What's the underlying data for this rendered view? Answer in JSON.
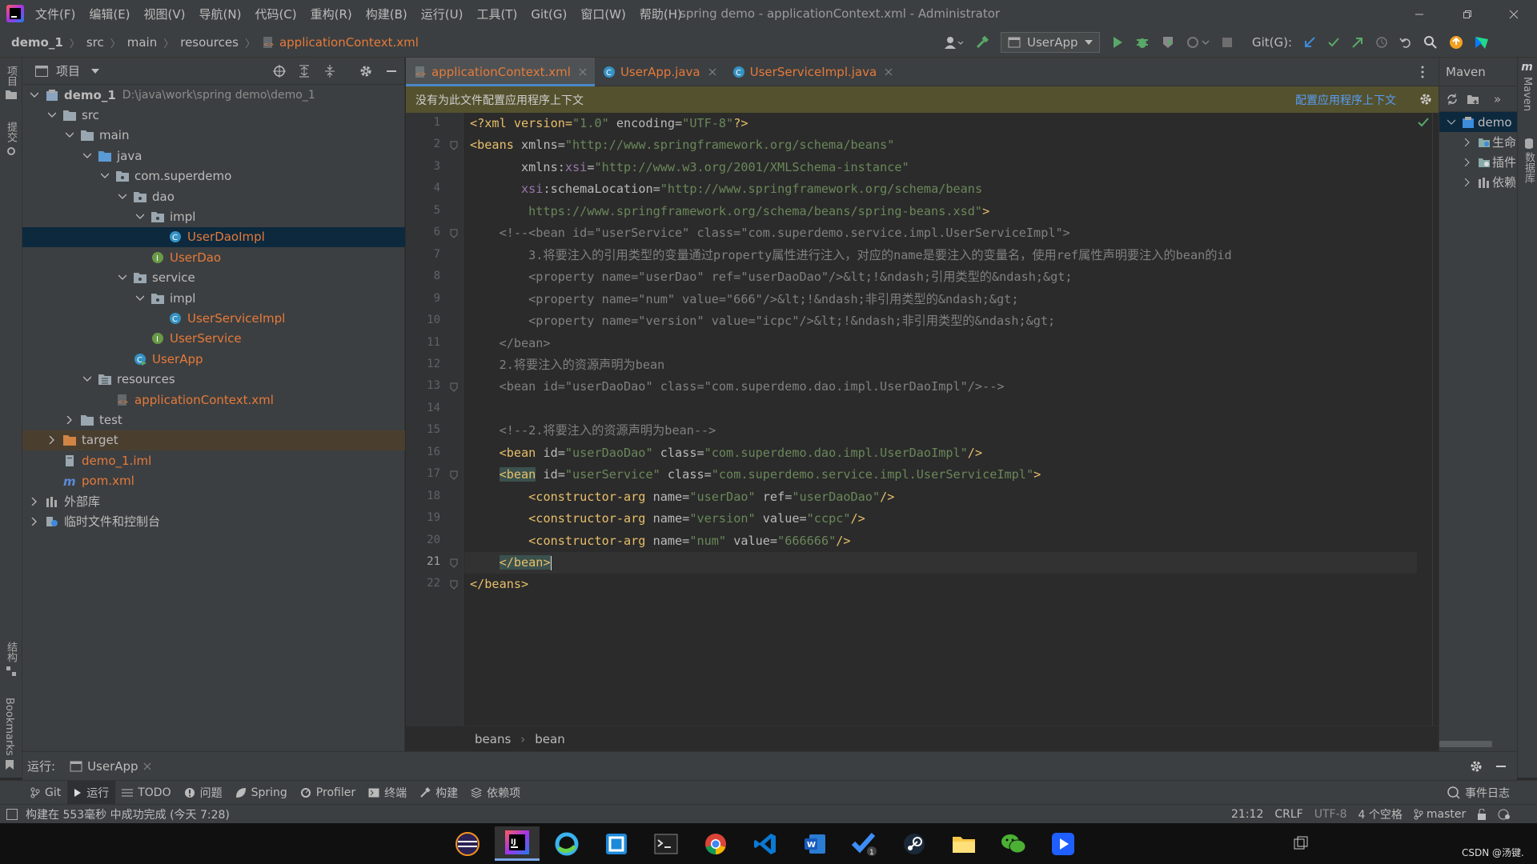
{
  "menubar": {
    "items": [
      "文件(F)",
      "编辑(E)",
      "视图(V)",
      "导航(N)",
      "代码(C)",
      "重构(R)",
      "构建(B)",
      "运行(U)",
      "工具(T)",
      "Git(G)",
      "窗口(W)",
      "帮助(H)"
    ],
    "title": "spring demo - applicationContext.xml - Administrator"
  },
  "navbar": {
    "crumbs": [
      "demo_1",
      "src",
      "main",
      "resources",
      "applicationContext.xml"
    ],
    "run_config": "UserApp",
    "git_label": "Git(G):"
  },
  "leftstrip": {
    "project": "项目",
    "commit": "提交",
    "structure": "结构",
    "bookmarks": "Bookmarks"
  },
  "project": {
    "header": "项目",
    "tree": [
      {
        "label": "demo_1",
        "path": "D:\\java\\work\\spring demo\\demo_1"
      },
      {
        "label": "src"
      },
      {
        "label": "main"
      },
      {
        "label": "java"
      },
      {
        "label": "com.superdemo"
      },
      {
        "label": "dao"
      },
      {
        "label": "impl"
      },
      {
        "label": "UserDaoImpl"
      },
      {
        "label": "UserDao"
      },
      {
        "label": "service"
      },
      {
        "label": "impl"
      },
      {
        "label": "UserServiceImpl"
      },
      {
        "label": "UserService"
      },
      {
        "label": "UserApp"
      },
      {
        "label": "resources"
      },
      {
        "label": "applicationContext.xml"
      },
      {
        "label": "test"
      },
      {
        "label": "target"
      },
      {
        "label": "demo_1.iml"
      },
      {
        "label": "pom.xml"
      },
      {
        "label": "外部库"
      },
      {
        "label": "临时文件和控制台"
      }
    ]
  },
  "tabs": [
    {
      "label": "applicationContext.xml",
      "active": true
    },
    {
      "label": "UserApp.java",
      "active": false
    },
    {
      "label": "UserServiceImpl.java",
      "active": false
    }
  ],
  "banner": {
    "text": "没有为此文件配置应用程序上下文",
    "action": "配置应用程序上下文"
  },
  "editor": {
    "line_numbers": [
      "1",
      "2",
      "3",
      "4",
      "5",
      "6",
      "7",
      "8",
      "9",
      "10",
      "11",
      "12",
      "13",
      "14",
      "15",
      "16",
      "17",
      "18",
      "19",
      "20",
      "21",
      "22"
    ],
    "current_line": "21",
    "lines": [
      [
        "<?xml version=",
        "\"1.0\"",
        " encoding=",
        "\"UTF-8\"",
        "?>"
      ],
      [
        "<beans",
        " xmlns=",
        "\"http://www.springframework.org/schema/beans\""
      ],
      [
        "       xmlns:",
        "xsi",
        "=",
        "\"http://www.w3.org/2001/XMLSchema-instance\""
      ],
      [
        "       ",
        "xsi",
        ":schemaLocation=",
        "\"http://www.springframework.org/schema/beans"
      ],
      [
        "        https://www.springframework.org/schema/beans/spring-beans.xsd\"",
        ">"
      ],
      [
        "    <!--<bean id=\"userService\" class=\"com.superdemo.service.impl.UserServiceImpl\">"
      ],
      [
        "        3.将要注入的引用类型的变量通过property属性进行注入，对应的name是要注入的变量名，使用ref属性声明要注入的bean的id"
      ],
      [
        "        <property name=\"userDao\" ref=\"userDaoDao\"/>&lt;!&ndash;引用类型的&ndash;&gt;"
      ],
      [
        "        <property name=\"num\" value=\"666\"/>&lt;!&ndash;非引用类型的&ndash;&gt;"
      ],
      [
        "        <property name=\"version\" value=\"icpc\"/>&lt;!&ndash;非引用类型的&ndash;&gt;"
      ],
      [
        "    </bean>"
      ],
      [
        "    2.将要注入的资源声明为bean"
      ],
      [
        "    <bean id=\"userDaoDao\" class=\"com.superdemo.dao.impl.UserDaoImpl\"/>-->"
      ],
      [
        ""
      ],
      [
        "    <!--2.将要注入的资源声明为bean-->"
      ],
      [
        "    ",
        "<bean",
        " id=",
        "\"userDaoDao\"",
        " class=",
        "\"com.superdemo.dao.impl.UserDaoImpl\"",
        "/>"
      ],
      [
        "    ",
        "<bean",
        " id=",
        "\"userService\"",
        " class=",
        "\"com.superdemo.service.impl.UserServiceImpl\"",
        ">"
      ],
      [
        "        ",
        "<constructor-arg",
        " name=",
        "\"userDao\"",
        " ref=",
        "\"userDaoDao\"",
        "/>"
      ],
      [
        "        ",
        "<constructor-arg",
        " name=",
        "\"version\"",
        " value=",
        "\"ccpc\"",
        "/>"
      ],
      [
        "        ",
        "<constructor-arg",
        " name=",
        "\"num\"",
        " value=",
        "\"666666\"",
        "/>"
      ],
      [
        "    ",
        "</bean>"
      ],
      [
        "</beans>"
      ]
    ],
    "breadcrumb": [
      "beans",
      "bean"
    ]
  },
  "maven": {
    "title": "Maven",
    "root": "demo",
    "items": [
      "生命",
      "插件",
      "依赖"
    ],
    "side_label": "Maven",
    "db_label": "数据库"
  },
  "run": {
    "label": "运行:",
    "config": "UserApp"
  },
  "toolwindows": [
    "Git",
    "运行",
    "TODO",
    "问题",
    "Spring",
    "Profiler",
    "终端",
    "构建",
    "依赖项"
  ],
  "event_log": "事件日志",
  "status": {
    "message": "构建在 553毫秒 中成功完成 (今天 7:28)",
    "position": "21:12",
    "line_sep": "CRLF",
    "encoding": "UTF-8",
    "indent": "4 个空格",
    "branch": "master"
  },
  "taskbar": {
    "apps": [
      "eclipse-icon",
      "intellij-icon",
      "edge-icon",
      "remote-icon",
      "terminal-icon",
      "chrome-icon",
      "vscode-icon",
      "word-icon",
      "todo-icon",
      "steam-icon",
      "explorer-icon",
      "wechat-icon",
      "video-icon"
    ],
    "tray_text": "CSDN @汤键."
  },
  "colors": {
    "accent": "#4a88c7",
    "selection": "#0d293e",
    "tag": "#e8bf6a",
    "string": "#6a8759",
    "comment": "#808080"
  }
}
